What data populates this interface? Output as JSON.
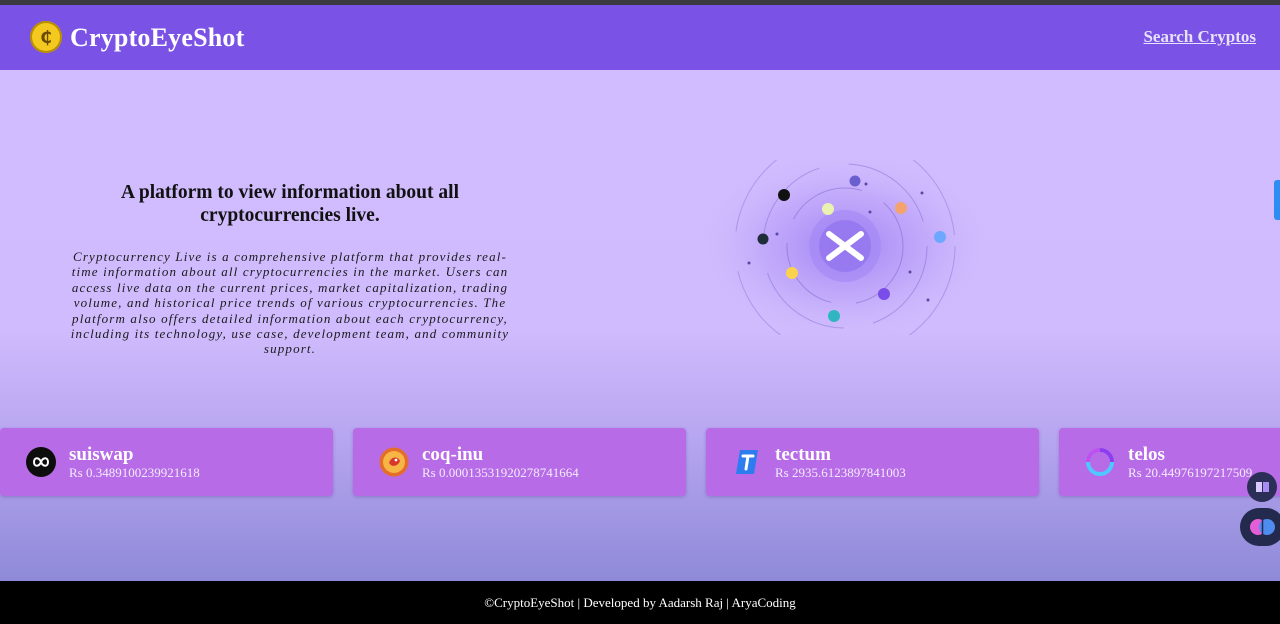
{
  "header": {
    "brand": "CryptoEyeShot",
    "logo_icon": "coin-icon",
    "search_link": "Search Cryptos"
  },
  "hero": {
    "title": "A platform to view information about all cryptocurrencies live.",
    "description": "Cryptocurrency Live is a comprehensive platform that provides real-time information about all cryptocurrencies in the market. Users can access live data on the current prices, market capitalization, trading volume, and historical price trends of various cryptocurrencies. The platform also offers detailed information about each cryptocurrency, including its technology, use case, development team, and community support.",
    "illustration_icon": "crypto-orbit-illustration"
  },
  "coins": [
    {
      "name": "suiswap",
      "price": "Rs 0.3489100239921618",
      "icon": "suiswap-icon"
    },
    {
      "name": "coq-inu",
      "price": "Rs 0.00013531920278741664",
      "icon": "coq-inu-icon"
    },
    {
      "name": "tectum",
      "price": "Rs 2935.6123897841003",
      "icon": "tectum-icon"
    },
    {
      "name": "telos",
      "price": "Rs 20.44976197217509",
      "icon": "telos-icon"
    }
  ],
  "footer": {
    "text": "©CryptoEyeShot | Developed by Aadarsh Raj | AryaCoding"
  },
  "colors": {
    "header_bg": "#7b52e6",
    "card_bg": "#b86be6",
    "footer_bg": "#000000",
    "accent_coin": "#f3c81f"
  }
}
